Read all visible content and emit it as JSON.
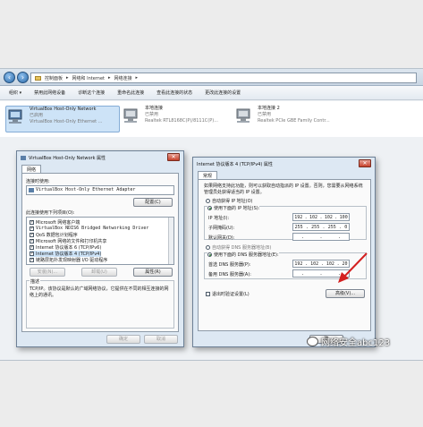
{
  "address_bar": {
    "crumbs": [
      "控制面板",
      "网络和 Internet",
      "网络连接"
    ]
  },
  "toolbar": {
    "items": [
      "组织 ▾",
      "禁用此网络设备",
      "诊断这个连接",
      "重命名此连接",
      "查看此连接的状态",
      "更改此连接的设置"
    ]
  },
  "connections": [
    {
      "name": "VirtualBox Host-Only Network",
      "status": "已启用",
      "device": "VirtualBox Host-Only Ethernet ..."
    },
    {
      "name": "本地连接",
      "status": "已禁用",
      "device": "Realtek RTL8168C(P)/8111C(P)..."
    },
    {
      "name": "本地连接 2",
      "status": "已禁用",
      "device": "Realtek PCIe GBE Family Contr..."
    }
  ],
  "props_dialog": {
    "title": "VirtualBox Host-Only Network 属性",
    "tab": "网络",
    "connect_using_label": "连接时使用:",
    "adapter": "VirtualBox Host-Only Ethernet Adapter",
    "configure_button": "配置(C)",
    "items_label": "此连接使用下列项目(O):",
    "items": [
      "Microsoft 网络客户端",
      "VirtualBox NDIS6 Bridged Networking Driver",
      "QoS 数据包计划程序",
      "Microsoft 网络的文件和打印机共享",
      "Internet 协议版本 6 (TCP/IPv6)",
      "Internet 协议版本 4 (TCP/IPv4)",
      "链路层拓扑发现映射器 I/O 驱动程序"
    ],
    "install_button": "安装(N)...",
    "uninstall_button": "卸载(U)",
    "properties_button": "属性(R)",
    "desc_title": "描述",
    "desc_text": "TCP/IP。该协议是默认的广域网络协议，它提供在不同的相互连接的网络上的通讯。",
    "ok_button": "确定",
    "cancel_button": "取消"
  },
  "ipv4_dialog": {
    "title": "Internet 协议版本 4 (TCP/IPv4) 属性",
    "tab": "常规",
    "intro": "如果网络支持此功能，则可以获取自动指派的 IP 设置。否则，您需要从网络系统管理员处获得适当的 IP 设置。",
    "auto_ip": "自动获得 IP 地址(O)",
    "manual_ip": "使用下面的 IP 地址(S):",
    "ip_label": "IP 地址(I):",
    "ip_value": [
      "192",
      "102",
      "102",
      "100"
    ],
    "mask_label": "子网掩码(U):",
    "mask_value": [
      "255",
      "255",
      "255",
      "0"
    ],
    "gateway_label": "默认网关(D):",
    "auto_dns": "自动获得 DNS 服务器地址(B)",
    "manual_dns": "使用下面的 DNS 服务器地址(E):",
    "dns1_label": "首选 DNS 服务器(P):",
    "dns1_value": [
      "192",
      "102",
      "102",
      "20"
    ],
    "dns2_label": "备用 DNS 服务器(A):",
    "validate_label": "退出时验证设置(L)",
    "advanced_button": "高级(V)...",
    "ok_button": "确"
  },
  "watermark": "网络安全abc123",
  "colors": {
    "arrow": "#d42020",
    "selection": "#cde3f7"
  }
}
